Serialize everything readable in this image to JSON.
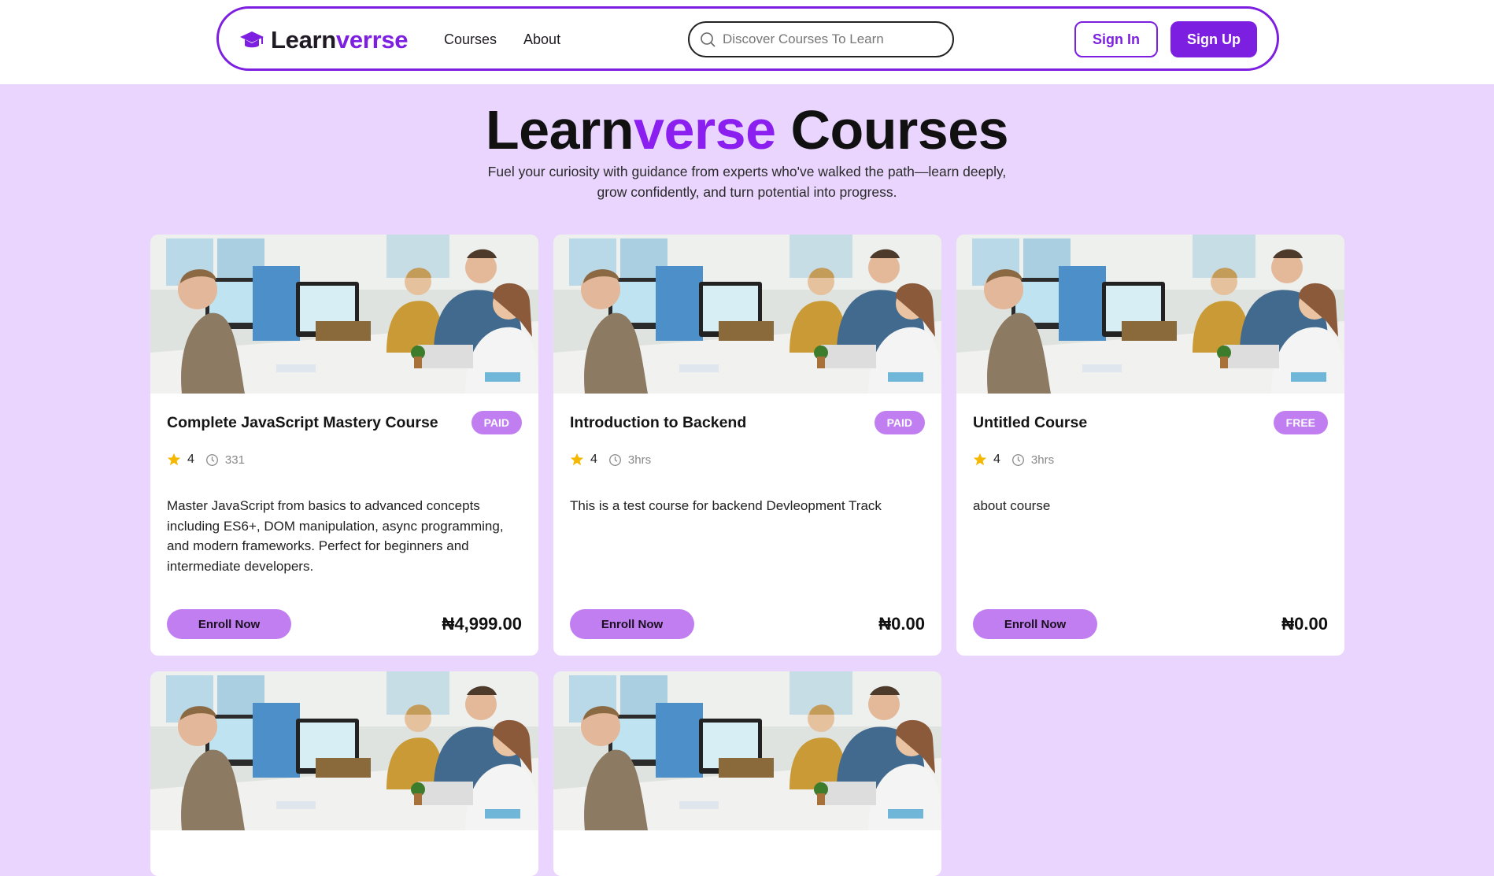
{
  "header": {
    "logo_prefix": "Learn",
    "logo_suffix": "verrse",
    "nav": [
      "Courses",
      "About"
    ],
    "search_placeholder": "Discover Courses To Learn",
    "sign_in": "Sign In",
    "sign_up": "Sign Up"
  },
  "hero": {
    "title_prefix": "Learn",
    "title_accent": "verse",
    "title_suffix": " Courses",
    "subtitle": "Fuel your curiosity with guidance from experts who've walked the path—learn deeply, grow confidently, and turn potential into progress."
  },
  "courses": [
    {
      "title": "Complete JavaScript Mastery Course",
      "badge": "PAID",
      "rating": "4",
      "duration": "331",
      "description": "Master JavaScript from basics to advanced concepts including ES6+, DOM manipulation, async programming, and modern frameworks. Perfect for beginners and intermediate developers.",
      "enroll": "Enroll Now",
      "price": "₦4,999.00"
    },
    {
      "title": "Introduction to Backend",
      "badge": "PAID",
      "rating": "4",
      "duration": "3hrs",
      "description": "This is a test course for backend Devleopment Track",
      "enroll": "Enroll Now",
      "price": "₦0.00"
    },
    {
      "title": "Untitled Course",
      "badge": "FREE",
      "rating": "4",
      "duration": "3hrs",
      "description": "about course",
      "enroll": "Enroll Now",
      "price": "₦0.00"
    }
  ],
  "colors": {
    "brand": "#7c1fe0",
    "page_bg": "#e9d5fd",
    "badge_bg": "#c07ef0",
    "star": "#f5b800"
  }
}
